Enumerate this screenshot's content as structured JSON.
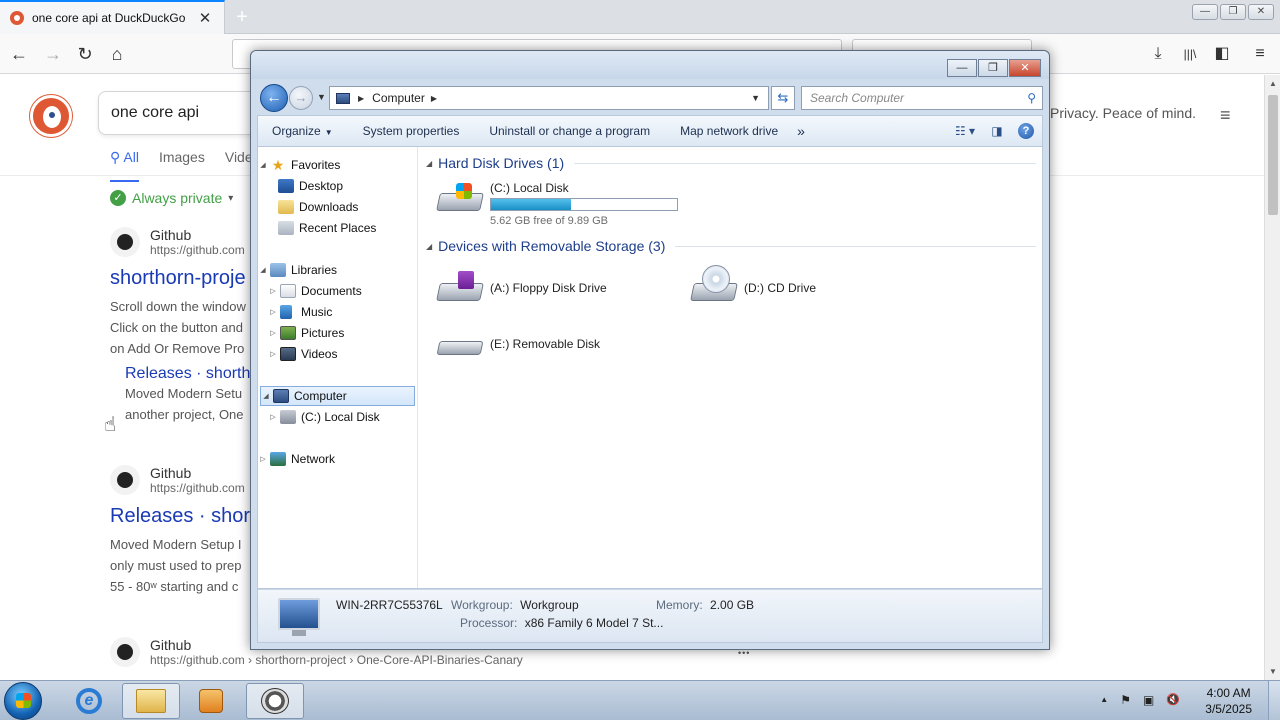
{
  "browser": {
    "tab_title": "one core api at DuckDuckGo",
    "close_glyph": "✕",
    "new_tab_glyph": "+",
    "nav": {
      "back": "←",
      "forward": "→",
      "reload": "↻",
      "home": "⌂"
    },
    "right_icons": {
      "downloads": "⤓",
      "library": "|||\\",
      "sidebar": "◧",
      "menu": "≡"
    },
    "win_ctrls": {
      "min": "—",
      "max": "❐",
      "close": "✕"
    }
  },
  "ddg": {
    "search_value": "one core api",
    "tagline": "Privacy. Peace of mind.",
    "menu_glyph": "≡",
    "tabs": [
      {
        "label": "All",
        "icon": "search-icon"
      },
      {
        "label": "Images"
      },
      {
        "label": "Vide"
      }
    ],
    "privacy_label": "Always private",
    "privacy_caret": "▾",
    "results": [
      {
        "source": "Github",
        "url": "https://github.com",
        "title": "shorthorn-proje",
        "snippet": [
          "Scroll down the window",
          "Click on the button and",
          "on Add Or Remove Pro"
        ],
        "sub_title": "Releases · shorth",
        "sub_snippet": [
          "Moved Modern Setu",
          "another project, One"
        ]
      },
      {
        "source": "Github",
        "url": "https://github.com",
        "title": "Releases · shor",
        "snippet": [
          "Moved Modern Setup I",
          "only must used to prep",
          "55 - 80ʷ starting and c"
        ]
      },
      {
        "source": "Github",
        "url": "https://github.com › shorthorn-project › One-Core-API-Binaries-Canary"
      }
    ],
    "more_glyph": "•••"
  },
  "explorer": {
    "win_ctrls": {
      "min": "—",
      "max": "❐",
      "close": "✕"
    },
    "back_glyph": "←",
    "forward_glyph": "→",
    "address": "Computer",
    "search_placeholder": "Search Computer",
    "search_glyph": "⚲",
    "refresh_glyph": "⇆",
    "toolbar": {
      "organize": "Organize",
      "system_properties": "System properties",
      "uninstall": "Uninstall or change a program",
      "map_drive": "Map network drive",
      "overflow": "»",
      "help": "?"
    },
    "nav_tree": {
      "favorites": "Favorites",
      "desktop": "Desktop",
      "downloads": "Downloads",
      "recent_places": "Recent Places",
      "libraries": "Libraries",
      "documents": "Documents",
      "music": "Music",
      "pictures": "Pictures",
      "videos": "Videos",
      "computer": "Computer",
      "local_disk": "(C:) Local Disk",
      "network": "Network"
    },
    "groups": {
      "hdd": "Hard Disk Drives (1)",
      "removable": "Devices with Removable Storage (3)"
    },
    "drives": {
      "c_name": "(C:) Local Disk",
      "c_free": "5.62 GB free of 9.89 GB",
      "c_used_fraction": 0.43,
      "a_name": "(A:) Floppy Disk Drive",
      "d_name": "(D:) CD Drive",
      "e_name": "(E:) Removable Disk"
    },
    "details": {
      "computer_name": "WIN-2RR7C55376L",
      "workgroup_label": "Workgroup:",
      "workgroup_value": "Workgroup",
      "memory_label": "Memory:",
      "memory_value": "2.00 GB",
      "processor_label": "Processor:",
      "processor_value": "x86 Family 6 Model 7 St..."
    }
  },
  "taskbar": {
    "ie_glyph": "e",
    "tray": {
      "up": "▲",
      "flag": "⚑",
      "network": "▣",
      "volume": "🔇"
    },
    "time": "4:00 AM",
    "date": "3/5/2025"
  }
}
